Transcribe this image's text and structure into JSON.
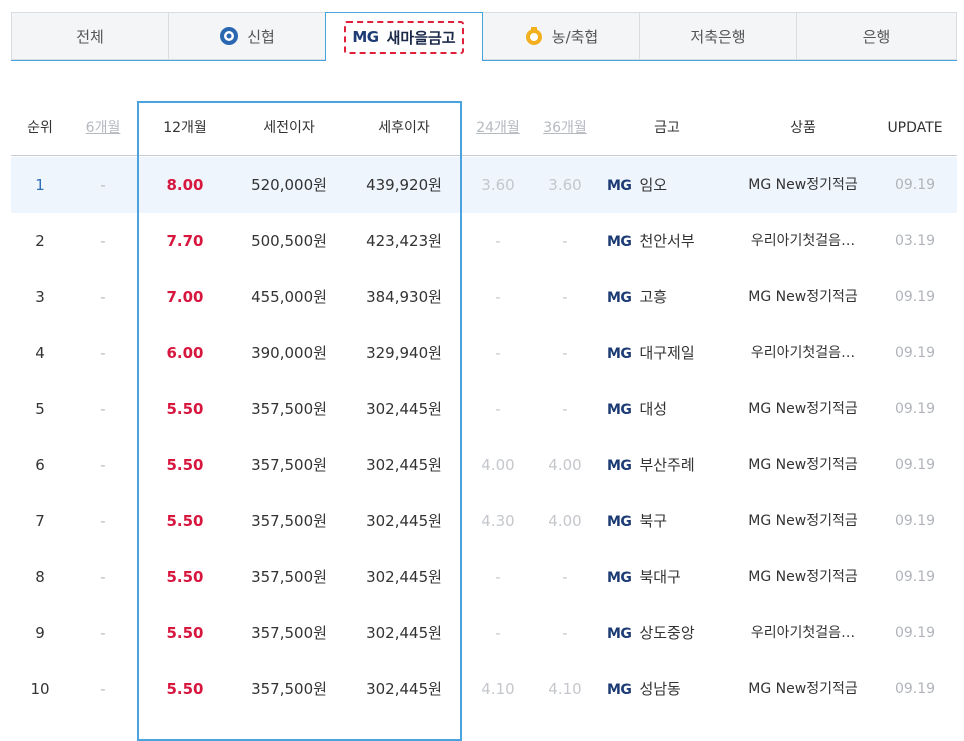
{
  "tabs": [
    {
      "label": "전체",
      "icon": ""
    },
    {
      "label": "신협",
      "icon": "shinhyup-logo-icon"
    },
    {
      "label": "새마을금고",
      "logo": "MG",
      "icon": "mg-logo-icon",
      "active": true
    },
    {
      "label": "농/축협",
      "icon": "nonghyup-logo-icon"
    },
    {
      "label": "저축은행",
      "icon": ""
    },
    {
      "label": "은행",
      "icon": ""
    }
  ],
  "colors": {
    "accent": "#4aa3df",
    "rate": "#d8173f",
    "active_outline": "#e0203a",
    "mg_brand": "#1d3b74"
  },
  "table": {
    "headers": {
      "rank": "순위",
      "m6": "6개월",
      "m12": "12개월",
      "pre_tax": "세전이자",
      "post_tax": "세후이자",
      "m24": "24개월",
      "m36": "36개월",
      "bank": "금고",
      "product": "상품",
      "update": "UPDATE"
    },
    "rows": [
      {
        "rank": "1",
        "m6": "-",
        "m12": "8.00",
        "pre": "520,000원",
        "post": "439,920원",
        "m24": "3.60",
        "m36": "3.60",
        "logo": "MG",
        "bank": "임오",
        "product": "MG New정기적금",
        "update": "09.19"
      },
      {
        "rank": "2",
        "m6": "-",
        "m12": "7.70",
        "pre": "500,500원",
        "post": "423,423원",
        "m24": "-",
        "m36": "-",
        "logo": "MG",
        "bank": "천안서부",
        "product": "우리아기첫걸음…",
        "update": "03.19"
      },
      {
        "rank": "3",
        "m6": "-",
        "m12": "7.00",
        "pre": "455,000원",
        "post": "384,930원",
        "m24": "-",
        "m36": "-",
        "logo": "MG",
        "bank": "고흥",
        "product": "MG New정기적금",
        "update": "09.19"
      },
      {
        "rank": "4",
        "m6": "-",
        "m12": "6.00",
        "pre": "390,000원",
        "post": "329,940원",
        "m24": "-",
        "m36": "-",
        "logo": "MG",
        "bank": "대구제일",
        "product": "우리아기첫걸음…",
        "update": "09.19"
      },
      {
        "rank": "5",
        "m6": "-",
        "m12": "5.50",
        "pre": "357,500원",
        "post": "302,445원",
        "m24": "-",
        "m36": "-",
        "logo": "MG",
        "bank": "대성",
        "product": "MG New정기적금",
        "update": "09.19"
      },
      {
        "rank": "6",
        "m6": "-",
        "m12": "5.50",
        "pre": "357,500원",
        "post": "302,445원",
        "m24": "4.00",
        "m36": "4.00",
        "logo": "MG",
        "bank": "부산주례",
        "product": "MG New정기적금",
        "update": "09.19"
      },
      {
        "rank": "7",
        "m6": "-",
        "m12": "5.50",
        "pre": "357,500원",
        "post": "302,445원",
        "m24": "4.30",
        "m36": "4.00",
        "logo": "MG",
        "bank": "북구",
        "product": "MG New정기적금",
        "update": "09.19"
      },
      {
        "rank": "8",
        "m6": "-",
        "m12": "5.50",
        "pre": "357,500원",
        "post": "302,445원",
        "m24": "-",
        "m36": "-",
        "logo": "MG",
        "bank": "북대구",
        "product": "MG New정기적금",
        "update": "09.19"
      },
      {
        "rank": "9",
        "m6": "-",
        "m12": "5.50",
        "pre": "357,500원",
        "post": "302,445원",
        "m24": "-",
        "m36": "-",
        "logo": "MG",
        "bank": "상도중앙",
        "product": "우리아기첫걸음…",
        "update": "09.19"
      },
      {
        "rank": "10",
        "m6": "-",
        "m12": "5.50",
        "pre": "357,500원",
        "post": "302,445원",
        "m24": "4.10",
        "m36": "4.10",
        "logo": "MG",
        "bank": "성남동",
        "product": "MG New정기적금",
        "update": "09.19"
      }
    ]
  }
}
